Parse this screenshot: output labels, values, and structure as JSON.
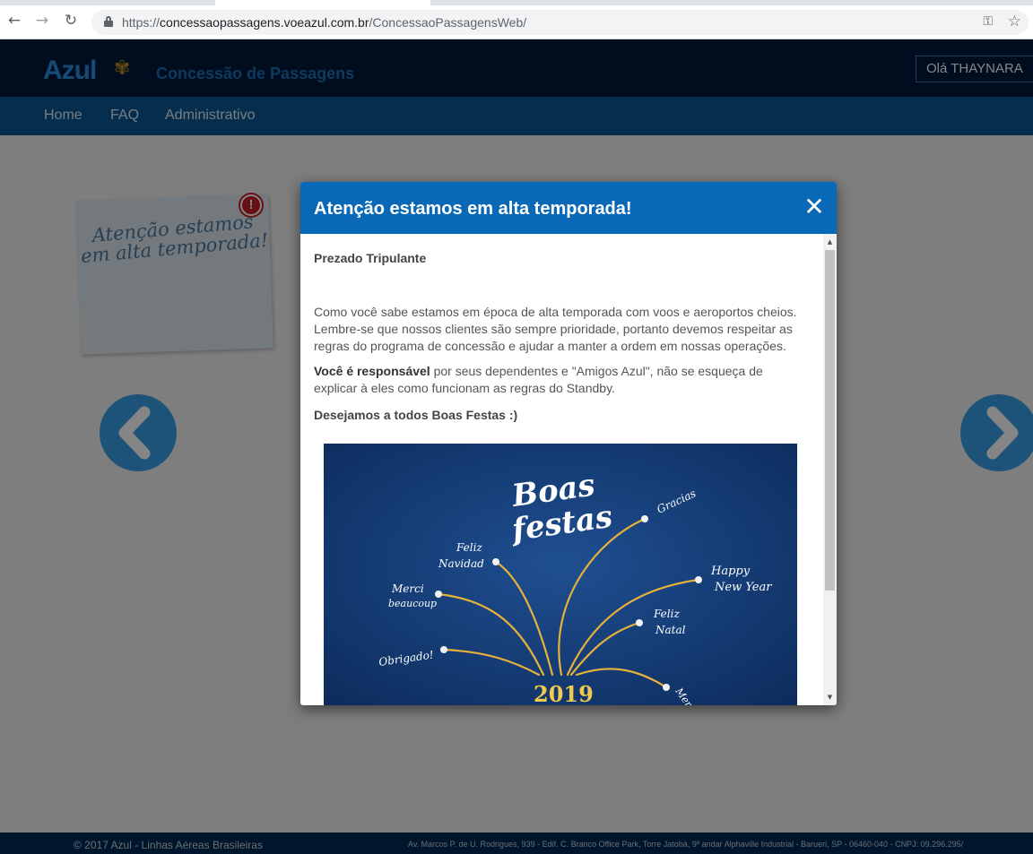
{
  "browser": {
    "back_icon": "←",
    "forward_icon": "→",
    "reload_icon": "↻",
    "url_scheme": "https://",
    "url_host": "concessaopassagens.voeazul.com.br",
    "url_path": "/ConcessaoPassagensWeb/",
    "key_icon": "⚿",
    "star_icon": "☆"
  },
  "header": {
    "logo": "Azul",
    "logo_mark": "✾",
    "site_title": "Concessão de Passagens",
    "greeting": "Olá THAYNARA"
  },
  "nav": {
    "items": [
      {
        "label": "Home"
      },
      {
        "label": "FAQ"
      },
      {
        "label": "Administrativo"
      }
    ]
  },
  "sticky_note": {
    "text": "Atenção estamos em alta temporada!",
    "alert_symbol": "!"
  },
  "carousel": {
    "prev_icon": "chevron-left-icon",
    "next_icon": "chevron-right-icon",
    "accent": "#3ba0e8"
  },
  "modal": {
    "title": "Atenção estamos em alta temporada!",
    "close_symbol": "✕",
    "greeting": "Prezado Tripulante",
    "paragraph1": "Como você sabe estamos em época de alta temporada com voos e aeroportos cheios. Lembre-se que nossos clientes são sempre prioridade, portanto devemos respeitar as regras do programa de concessão e ajudar a manter a ordem em nossas operações.",
    "paragraph2_bold": "Você é responsável",
    "paragraph2_rest": " por seus dependentes e \"Amigos Azul\", não se esqueça de explicar à eles como funcionam as regras do Standby.",
    "wishes": "Desejamos a todos Boas Festas :)",
    "header_color": "#0969b7"
  },
  "festive_image": {
    "title_line1": "Boas",
    "title_line2": "festas",
    "year": "2019",
    "greetings": [
      "Gracias",
      "Feliz",
      "Navidad",
      "Happy",
      "New Year",
      "Merci",
      "beaucoup",
      "Feliz",
      "Natal",
      "Obrigado!",
      "Merry"
    ]
  },
  "footer": {
    "copyright": "© 2017 Azul - Linhas Aéreas Brasileiras",
    "address": "Av. Marcos P. de U. Rodrigues, 939 - Edif. C. Branco Office Park, Torre Jatobá, 9º andar Alphaville Industrial - Barueri, SP - 06460-040 - CNPJ: 09.296.295/"
  }
}
